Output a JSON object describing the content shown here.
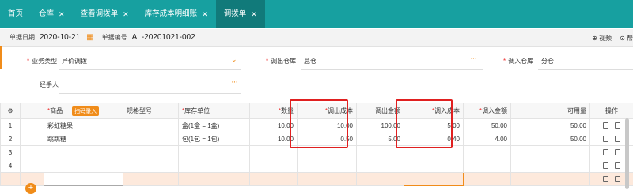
{
  "tabs": [
    {
      "label": "首页",
      "closable": false,
      "active": false
    },
    {
      "label": "仓库",
      "closable": true,
      "active": false
    },
    {
      "label": "查看调拨单",
      "closable": true,
      "active": false
    },
    {
      "label": "库存成本明细账",
      "closable": true,
      "active": false
    },
    {
      "label": "调拨单",
      "closable": true,
      "active": true
    }
  ],
  "doc": {
    "date_label": "单据日期",
    "date_value": "2020-10-21",
    "number_label": "单据编号",
    "number_value": "AL-20201021-002",
    "video_label": "视频",
    "help_label": "帮"
  },
  "form": {
    "business_type_label": "业务类型",
    "business_type_value": "异价调拨",
    "out_wh_label": "调出仓库",
    "out_wh_value": "总仓",
    "in_wh_label": "调入仓库",
    "in_wh_value": "分仓",
    "handler_label": "经手人",
    "handler_value": ""
  },
  "grid": {
    "columns": {
      "product": "商品",
      "scan_badge": "扫码录入",
      "spec": "规格型号",
      "unit": "库存单位",
      "qty": "数量",
      "out_cost": "调出成本",
      "out_amount": "调出金额",
      "in_cost": "调入成本",
      "in_amount": "调入金额",
      "available": "可用量",
      "ops": "操作"
    },
    "rows": [
      {
        "no": "1",
        "product": "彩虹糖果",
        "spec": "",
        "unit": "盒(1盒 = 1盒)",
        "qty": "10.00",
        "out_cost": "10.00",
        "out_amount": "100.00",
        "in_cost": "5.00",
        "in_amount": "50.00",
        "available": "50.00"
      },
      {
        "no": "2",
        "product": "跳跳糖",
        "spec": "",
        "unit": "包(1包 = 1包)",
        "qty": "10.00",
        "out_cost": "0.50",
        "out_amount": "5.00",
        "in_cost": "0.40",
        "in_amount": "4.00",
        "available": "50.00"
      },
      {
        "no": "3",
        "product": "",
        "spec": "",
        "unit": "",
        "qty": "",
        "out_cost": "",
        "out_amount": "",
        "in_cost": "",
        "in_amount": "",
        "available": ""
      },
      {
        "no": "4",
        "product": "",
        "spec": "",
        "unit": "",
        "qty": "",
        "out_cost": "",
        "out_amount": "",
        "in_cost": "",
        "in_amount": "",
        "available": ""
      }
    ]
  },
  "colors": {
    "brand": "#17a0a0",
    "accent": "#f08c1a",
    "highlight_box": "#e02020"
  }
}
